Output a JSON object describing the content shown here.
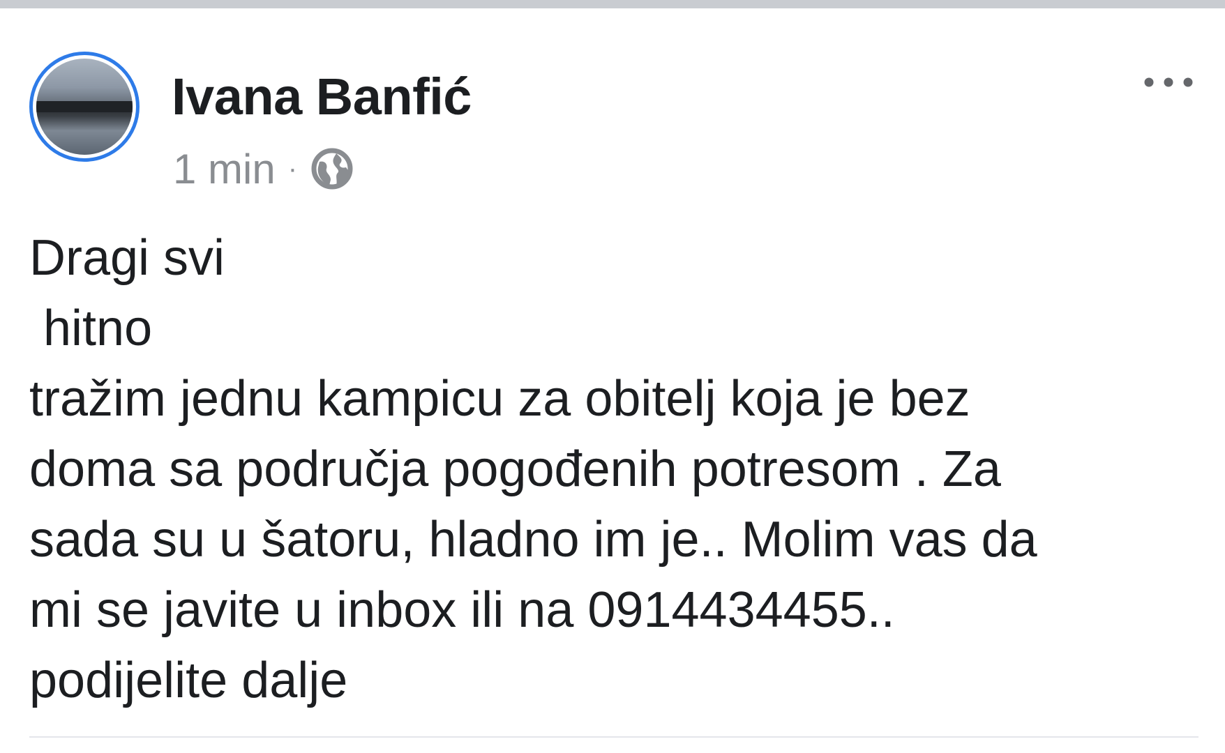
{
  "post": {
    "author_name": "Ivana Banfić",
    "timestamp": "1 min",
    "separator": "·",
    "audience_icon": "globe-icon",
    "more_icon": "more-options-icon",
    "text": "Dragi svi\n hitno\ntražim jednu kampicu za obitelj koja je bez\ndoma sa područja pogođenih potresom . Za\nsada su u šatoru, hladno im je.. Molim vas da\nmi se javite u inbox ili na 0914434455..\npodijelite dalje"
  },
  "colors": {
    "avatar_ring": "#2e7be8",
    "meta_text": "#8a8d91",
    "body_text": "#1c1e21"
  }
}
